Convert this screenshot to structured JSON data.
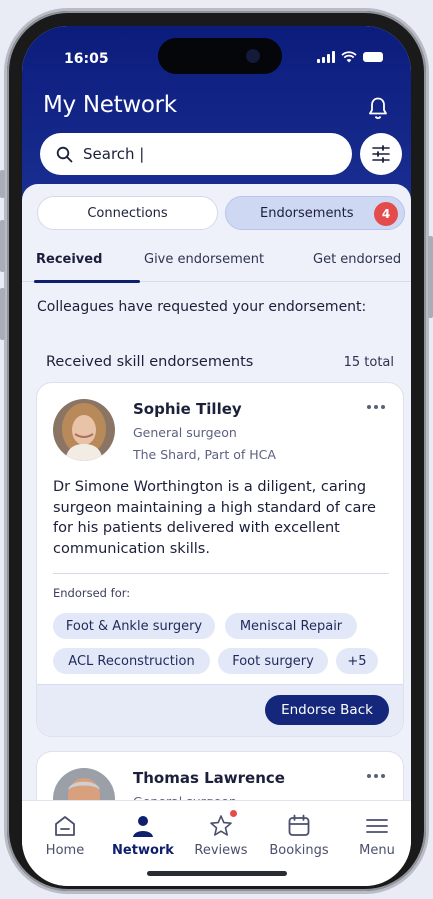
{
  "status_bar": {
    "time": "16:05"
  },
  "header": {
    "title": "My Network",
    "search_value": "Search |"
  },
  "segments": {
    "connections_label": "Connections",
    "endorsements_label": "Endorsements",
    "endorsements_badge": "4"
  },
  "tabs": [
    {
      "label": "Received",
      "active": true
    },
    {
      "label": "Give endorsement",
      "active": false
    },
    {
      "label": "Get endorsed",
      "active": false
    }
  ],
  "section_note": "Colleagues have requested your endorsement:",
  "list": {
    "title": "Received skill endorsements",
    "count": "15 total"
  },
  "cards": [
    {
      "name": "Sophie Tilley",
      "role": "General surgeon",
      "place": "The Shard, Part of HCA",
      "quote": "Dr Simone Worthington is a diligent, caring surgeon maintaining a high standard of care for his patients delivered with excellent communication skills.",
      "endorsed_for_label": "Endorsed for:",
      "skills": [
        "Foot & Ankle surgery",
        "Meniscal Repair",
        "ACL Reconstruction",
        "Foot surgery",
        "+5"
      ],
      "action_label": "Endorse Back"
    },
    {
      "name": "Thomas Lawrence",
      "role": "General surgeon"
    }
  ],
  "bottom_nav": [
    {
      "label": "Home",
      "icon": "home-icon",
      "active": false
    },
    {
      "label": "Network",
      "icon": "person-icon",
      "active": true
    },
    {
      "label": "Reviews",
      "icon": "star-icon",
      "active": false,
      "notification": true
    },
    {
      "label": "Bookings",
      "icon": "calendar-icon",
      "active": false
    },
    {
      "label": "Menu",
      "icon": "menu-icon",
      "active": false
    }
  ],
  "colors": {
    "brand_navy": "#0e1f6e",
    "header_gradient_top": "#0b1c7c",
    "badge_red": "#e44b4b",
    "chip_bg": "#e3e8f8"
  }
}
